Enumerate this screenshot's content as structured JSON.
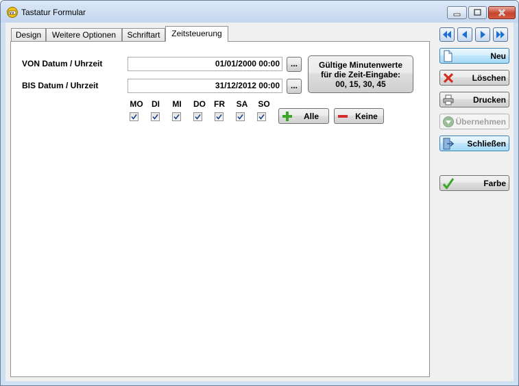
{
  "window": {
    "title": "Tastatur Formular"
  },
  "tabs": [
    {
      "label": "Design"
    },
    {
      "label": "Weitere Optionen"
    },
    {
      "label": "Schriftart"
    },
    {
      "label": "Zeitsteuerung"
    }
  ],
  "form": {
    "von_label": "VON Datum / Uhrzeit",
    "von_value": "01/01/2000 00:00",
    "bis_label": "BIS Datum / Uhrzeit",
    "bis_value": "31/12/2012 00:00",
    "browse_label": "...",
    "info_line1": "Gültige Minutenwerte",
    "info_line2": "für die Zeit-Eingabe:",
    "info_line3": "00,  15,  30,  45",
    "days": [
      {
        "label": "MO",
        "checked": true
      },
      {
        "label": "DI",
        "checked": true
      },
      {
        "label": "MI",
        "checked": true
      },
      {
        "label": "DO",
        "checked": true
      },
      {
        "label": "FR",
        "checked": true
      },
      {
        "label": "SA",
        "checked": true
      },
      {
        "label": "SO",
        "checked": true
      }
    ],
    "all_label": "Alle",
    "none_label": "Keine"
  },
  "sidebar": {
    "new_label": "Neu",
    "delete_label": "Löschen",
    "print_label": "Drucken",
    "apply_label": "Übernehmen",
    "close_label": "Schließen",
    "color_label": "Farbe"
  },
  "icons": {
    "nav": [
      "first-record-icon",
      "previous-record-icon",
      "next-record-icon",
      "last-record-icon"
    ],
    "new": "new-document-icon",
    "delete": "red-x-icon",
    "print": "printer-icon",
    "apply": "down-arrow-circle-icon",
    "close": "exit-door-icon",
    "color": "green-check-icon",
    "all": "green-plus-icon",
    "none": "red-minus-icon"
  },
  "colors": {
    "accent_blue": "#1d6fd1",
    "plus_green": "#3aa526",
    "minus_red": "#d62b2b",
    "delete_red": "#d42b1f"
  }
}
